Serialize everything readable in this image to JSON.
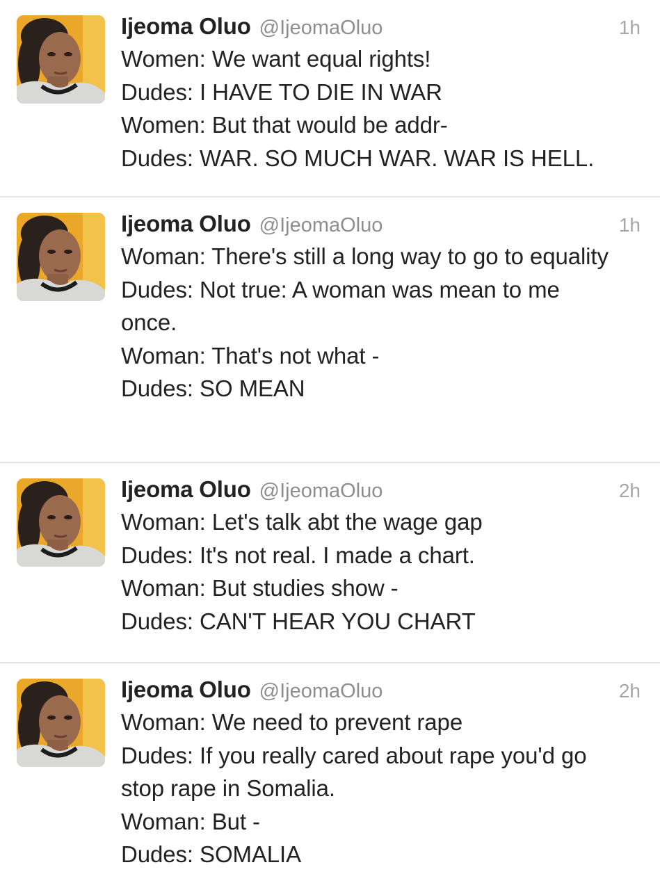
{
  "accent": "#222222",
  "muted": "#8e8e8e",
  "tweets": [
    {
      "display_name": "Ijeoma Oluo",
      "handle": "@IjeomaOluo",
      "time": "1h",
      "avatar_icon": "profile-photo",
      "lines": [
        "Women: We want equal rights!",
        "Dudes: I HAVE TO DIE IN WAR",
        "Women: But that would be addr-",
        "Dudes: WAR. SO MUCH WAR. WAR IS HELL."
      ]
    },
    {
      "display_name": "Ijeoma Oluo",
      "handle": "@IjeomaOluo",
      "time": "1h",
      "avatar_icon": "profile-photo",
      "lines": [
        "Woman: There's still a long way to go to equality",
        "Dudes: Not true: A woman was mean to me once.",
        "Woman: That's not what -",
        "Dudes: SO MEAN"
      ]
    },
    {
      "display_name": "Ijeoma Oluo",
      "handle": "@IjeomaOluo",
      "time": "2h",
      "avatar_icon": "profile-photo",
      "lines": [
        "Woman: Let's talk abt the wage gap",
        "Dudes: It's not real. I made a chart.",
        "Woman: But studies show -",
        "Dudes: CAN'T HEAR YOU CHART"
      ]
    },
    {
      "display_name": "Ijeoma Oluo",
      "handle": "@IjeomaOluo",
      "time": "2h",
      "avatar_icon": "profile-photo",
      "lines": [
        "Woman: We need to prevent rape",
        "Dudes: If you really cared about rape you'd go stop rape in Somalia.",
        "Woman: But -",
        "Dudes: SOMALIA"
      ]
    }
  ]
}
